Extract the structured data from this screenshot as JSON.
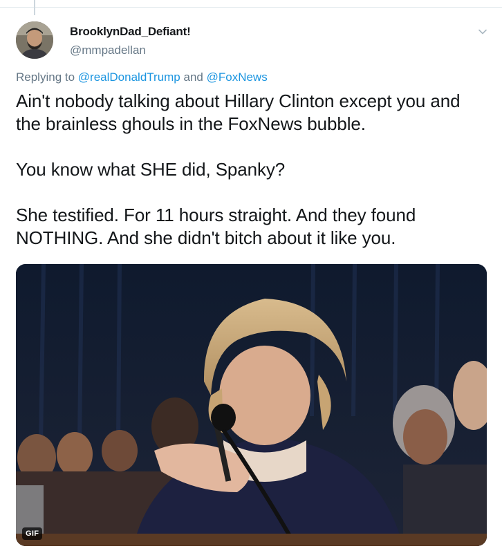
{
  "author": {
    "display_name": "BrooklynDad_Defiant!",
    "handle": "@mmpadellan"
  },
  "reply": {
    "prefix": "Replying to",
    "mention1": "@realDonaldTrump",
    "conjunction": "and",
    "mention2": "@FoxNews"
  },
  "tweet": {
    "paragraphs": [
      "Ain't nobody talking about Hillary Clinton except you and the brainless ghouls in the FoxNews bubble.",
      "You know what SHE did, Spanky?",
      "She testified. For 11 hours straight. And they found NOTHING. And she didn't bitch about it like you."
    ]
  },
  "media": {
    "badge": "GIF"
  },
  "icons": {
    "menu": "chevron-down-icon"
  },
  "colors": {
    "link": "#1b95e0",
    "secondary_text": "#657786",
    "primary_text": "#14171a"
  }
}
